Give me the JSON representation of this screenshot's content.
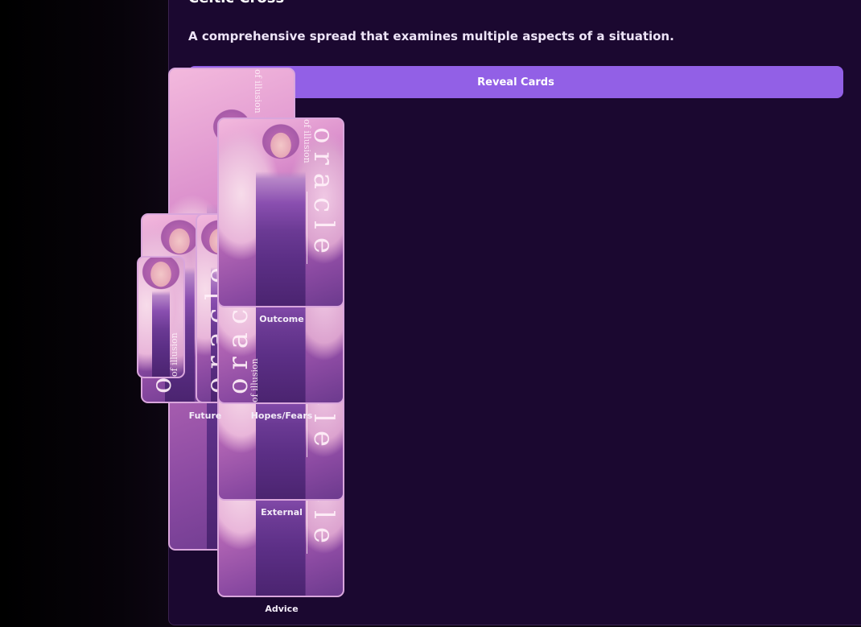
{
  "spread": {
    "title": "Celtic Cross",
    "description": "A comprehensive spread that examines multiple aspects of a situation."
  },
  "actions": {
    "reveal_label": "Reveal Cards"
  },
  "card_art": {
    "script_text": "oracle",
    "sub_text": "of illusion"
  },
  "positions": {
    "outcome": "Outcome",
    "future": "Future",
    "hopes_fears": "Hopes/Fears",
    "external": "External",
    "advice": "Advice"
  },
  "colors": {
    "background": "#000000",
    "panel": "#1b0830",
    "button": "#9260e6"
  }
}
